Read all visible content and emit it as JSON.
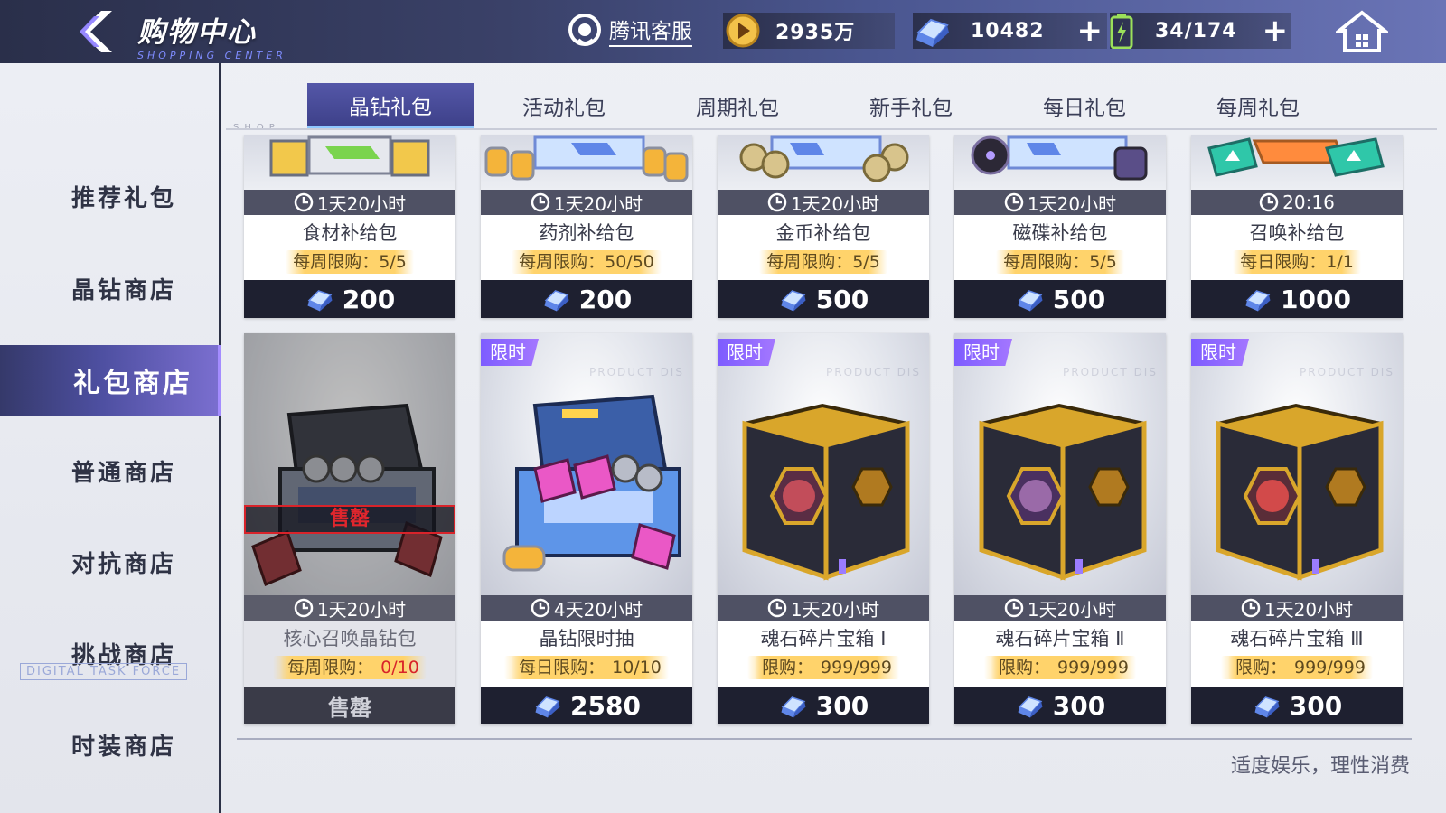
{
  "header": {
    "title": "购物中心",
    "subtitle": "SHOPPING CENTER",
    "customer_service": "腾讯客服",
    "gold": "2935万",
    "crystal": "10482",
    "stamina": "34/174"
  },
  "nav": {
    "items": [
      {
        "label": "推荐礼包"
      },
      {
        "label": "晶钻商店"
      },
      {
        "label": "礼包商店"
      },
      {
        "label": "普通商店"
      },
      {
        "label": "对抗商店"
      },
      {
        "label": "挑战商店"
      },
      {
        "label": "时装商店"
      }
    ],
    "active": "礼包商店",
    "deco": "DIGITAL TASK FORCE"
  },
  "tabs": {
    "items": [
      "晶钻礼包",
      "活动礼包",
      "周期礼包",
      "新手礼包",
      "每日礼包",
      "每周礼包"
    ],
    "active": "晶钻礼包",
    "deco": "SHOP"
  },
  "products_top": [
    {
      "timer": "1天20小时",
      "name": "食材补给包",
      "limit": "每周限购：5/5",
      "price": "200"
    },
    {
      "timer": "1天20小时",
      "name": "药剂补给包",
      "limit": "每周限购：50/50",
      "price": "200"
    },
    {
      "timer": "1天20小时",
      "name": "金币补给包",
      "limit": "每周限购：5/5",
      "price": "500"
    },
    {
      "timer": "1天20小时",
      "name": "磁碟补给包",
      "limit": "每周限购：5/5",
      "price": "500"
    },
    {
      "timer": "20:16",
      "name": "召唤补给包",
      "limit": "每日限购：1/1",
      "price": "1000"
    }
  ],
  "products_bottom": [
    {
      "tag": "",
      "timer": "1天20小时",
      "name": "核心召唤晶钻包",
      "limit_prefix": "每周限购：",
      "limit_value": "0/10",
      "price": "售罄",
      "sold_out_banner": "售罄"
    },
    {
      "tag": "限时",
      "timer": "4天20小时",
      "name": "晶钻限时抽",
      "limit_prefix": "每日限购：",
      "limit_value": "10/10",
      "price": "2580"
    },
    {
      "tag": "限时",
      "timer": "1天20小时",
      "name": "魂石碎片宝箱 Ⅰ",
      "limit_prefix": "限购：",
      "limit_value": "999/999",
      "price": "300"
    },
    {
      "tag": "限时",
      "timer": "1天20小时",
      "name": "魂石碎片宝箱 Ⅱ",
      "limit_prefix": "限购：",
      "limit_value": "999/999",
      "price": "300"
    },
    {
      "tag": "限时",
      "timer": "1天20小时",
      "name": "魂石碎片宝箱 Ⅲ",
      "limit_prefix": "限购：",
      "limit_value": "999/999",
      "price": "300"
    }
  ],
  "watermark": "PRODUCT DIS",
  "footer": "适度娱乐，理性消费",
  "colors": {
    "accent": "#4d4fa0",
    "limit_bg": "#ffd36b",
    "sold_out": "#e0262d",
    "price_bar": "#1e2030",
    "limited_tag": "#8a66ff"
  }
}
